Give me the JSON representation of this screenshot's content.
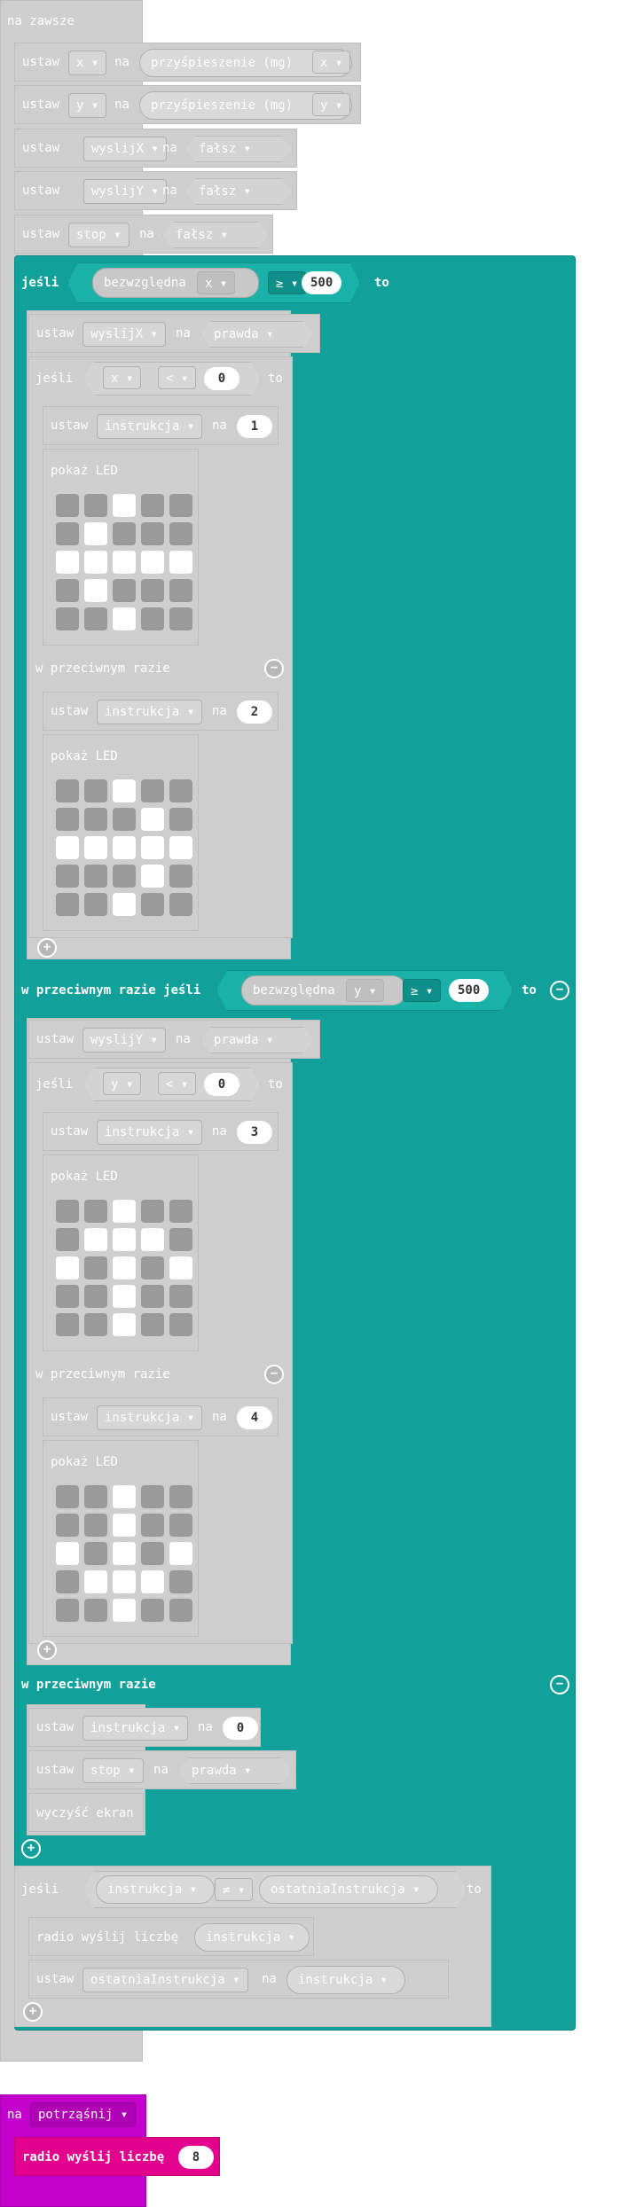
{
  "forever": {
    "label": "na zawsze"
  },
  "set": "ustaw",
  "to": "na",
  "stmt1": {
    "var": "x",
    "value": "przyśpieszenie (mg)",
    "axis": "x"
  },
  "stmt2": {
    "var": "y",
    "value": "przyśpieszenie (mg)",
    "axis": "y"
  },
  "stmt3": {
    "var": "wyslijX",
    "value": "fałsz"
  },
  "stmt4": {
    "var": "wyslijY",
    "value": "fałsz"
  },
  "stmt5": {
    "var": "stop",
    "value": "fałsz"
  },
  "if1": {
    "if": "jeśli",
    "fn": "bezwzględna",
    "arg": "x",
    "op": "≥",
    "num": "500",
    "then": "to"
  },
  "b1": {
    "var": "wyslijX",
    "value": "prawda"
  },
  "if2": {
    "if": "jeśli",
    "var": "x",
    "op": "<",
    "num": "0",
    "then": "to"
  },
  "c1": {
    "var": "instrukcja",
    "num": "1",
    "show": "pokaż LED"
  },
  "else1": "w przeciwnym razie",
  "c2": {
    "var": "instrukcja",
    "num": "2",
    "show": "pokaż LED"
  },
  "elseif": {
    "label": "w przeciwnym razie jeśli",
    "fn": "bezwzględna",
    "arg": "y",
    "op": "≥",
    "num": "500",
    "then": "to"
  },
  "b2": {
    "var": "wyslijY",
    "value": "prawda"
  },
  "if3": {
    "if": "jeśli",
    "var": "y",
    "op": "<",
    "num": "0",
    "then": "to"
  },
  "c3": {
    "var": "instrukcja",
    "num": "3",
    "show": "pokaż LED"
  },
  "else2": "w przeciwnym razie",
  "c4": {
    "var": "instrukcja",
    "num": "4",
    "show": "pokaż LED"
  },
  "else3": "w przeciwnym razie",
  "e1": {
    "var": "instrukcja",
    "num": "0"
  },
  "e2": {
    "var": "stop",
    "value": "prawda"
  },
  "e3": {
    "label": "wyczyść ekran"
  },
  "if4": {
    "if": "jeśli",
    "left": "instrukcja",
    "op": "≠",
    "right": "ostatniaInstrukcja",
    "then": "to"
  },
  "r1": {
    "label": "radio wyślij liczbę",
    "arg": "instrukcja"
  },
  "r2": {
    "var": "ostatniaInstrukcja",
    "value": "instrukcja"
  },
  "shake": {
    "on": "na",
    "event": "potrząśnij"
  },
  "r3": {
    "label": "radio wyślij liczbę",
    "num": "8"
  },
  "led_grids": {
    "g1": [
      [
        0,
        0,
        1,
        0,
        0
      ],
      [
        0,
        1,
        0,
        0,
        0
      ],
      [
        1,
        1,
        1,
        1,
        1
      ],
      [
        0,
        1,
        0,
        0,
        0
      ],
      [
        0,
        0,
        1,
        0,
        0
      ]
    ],
    "g2": [
      [
        0,
        0,
        1,
        0,
        0
      ],
      [
        0,
        0,
        0,
        1,
        0
      ],
      [
        1,
        1,
        1,
        1,
        1
      ],
      [
        0,
        0,
        0,
        1,
        0
      ],
      [
        0,
        0,
        1,
        0,
        0
      ]
    ],
    "g3": [
      [
        0,
        0,
        1,
        0,
        0
      ],
      [
        0,
        1,
        1,
        1,
        0
      ],
      [
        1,
        0,
        1,
        0,
        1
      ],
      [
        0,
        0,
        1,
        0,
        0
      ],
      [
        0,
        0,
        1,
        0,
        0
      ]
    ],
    "g4": [
      [
        0,
        0,
        1,
        0,
        0
      ],
      [
        0,
        0,
        1,
        0,
        0
      ],
      [
        1,
        0,
        1,
        0,
        1
      ],
      [
        0,
        1,
        1,
        1,
        0
      ],
      [
        0,
        0,
        1,
        0,
        0
      ]
    ]
  },
  "colors": {
    "logic": "#12a19a",
    "basic": "#cecece",
    "input": "#c400cc",
    "radio": "#e2008c"
  }
}
